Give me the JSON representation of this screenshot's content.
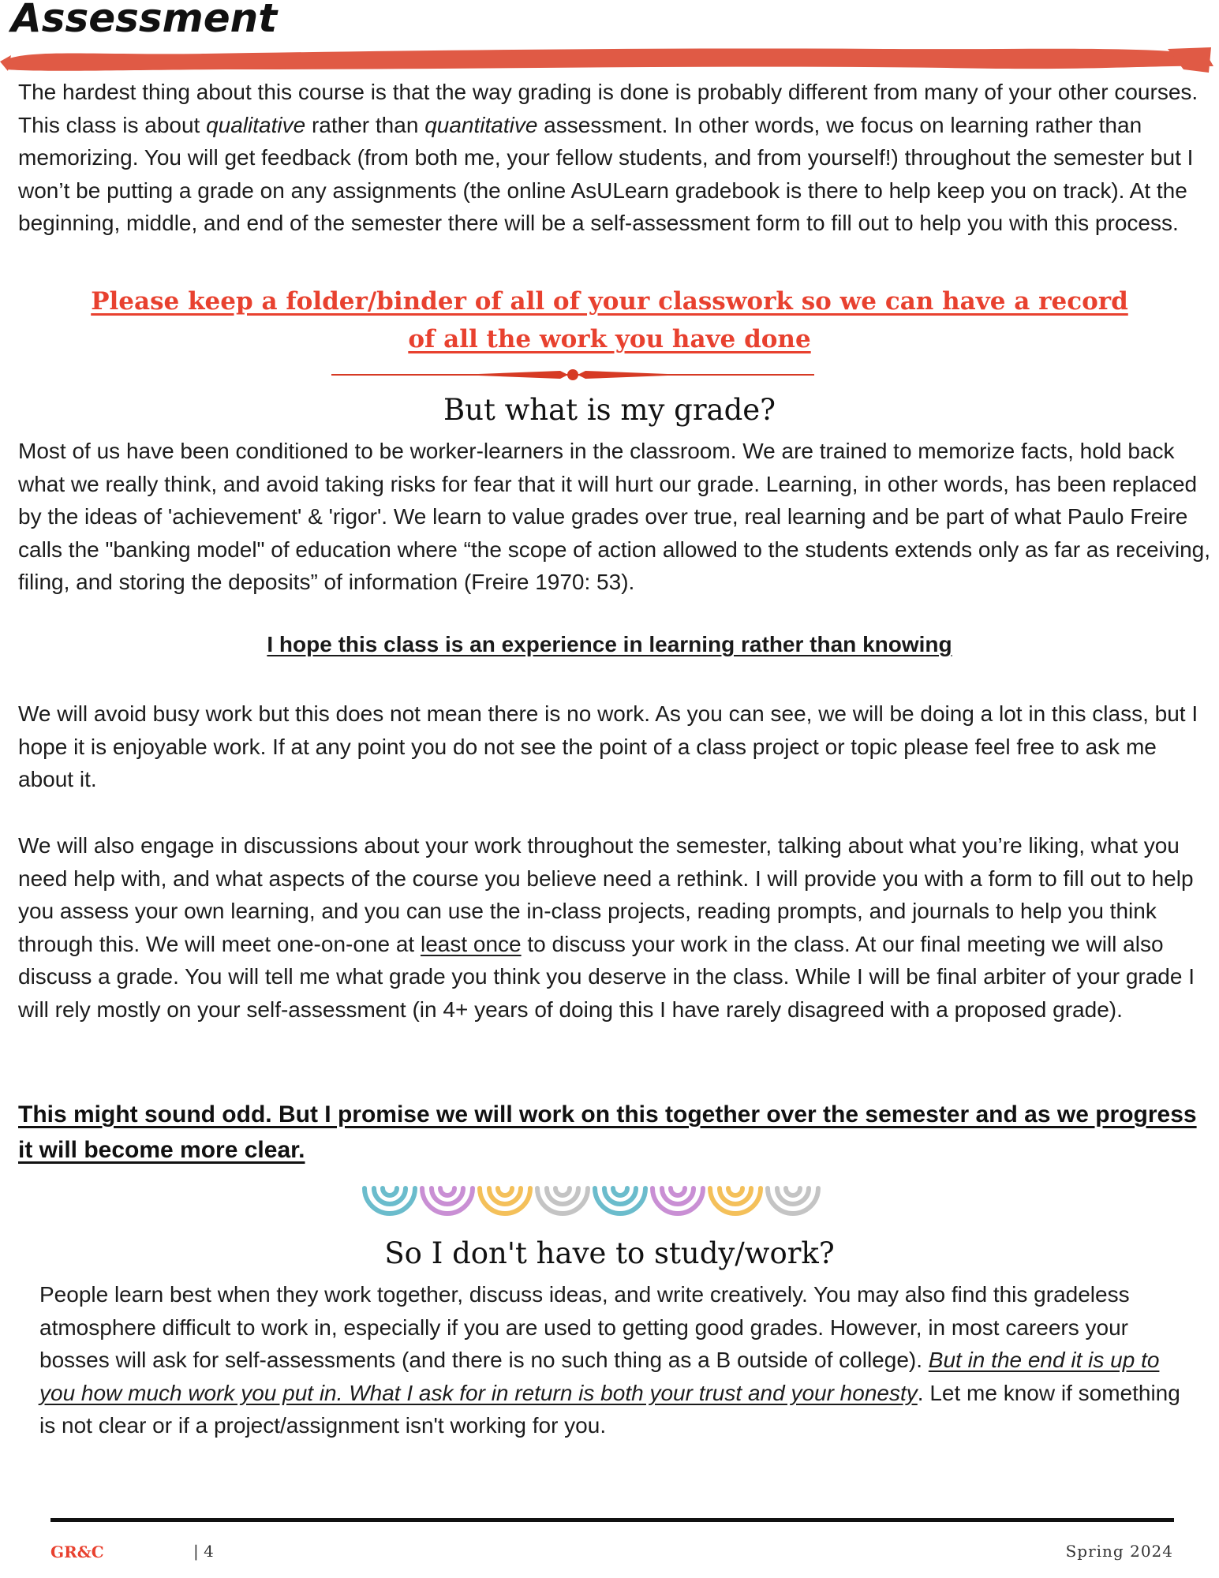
{
  "title": "Assessment",
  "intro": {
    "part1": "The hardest thing about this course is that the way grading is done is probably different from many of your other courses. This class is about ",
    "qualitative": "qualitative",
    "part2": " rather than ",
    "quantitative": "quantitative",
    "part3": " assessment. In other words, we focus on learning rather than memorizing. You will get feedback (from both me, your fellow students, and from yourself!) throughout the semester but I won’t be putting a grade on any assignments (the online AsULearn gradebook is there to help keep you on track). At the beginning, middle, and end of the semester there will be a self-assessment form to fill out to help you with this process."
  },
  "callout": {
    "line1": "Please keep a folder/binder of all of your classwork so we can have a record",
    "line2": "of all the work you have done"
  },
  "section1": {
    "heading": "But what is my grade?",
    "paragraph": "Most of us have been conditioned to be worker-learners in the classroom. We are trained to memorize facts, hold back what we really think, and avoid taking risks for fear that it will hurt our grade. Learning, in other words, has been replaced by the ideas of 'achievement' & 'rigor'. We learn to value grades over true, real learning and be part of what Paulo Freire calls the \"banking model\" of education where “the scope of action allowed to the students extends only as far as receiving, filing, and storing the deposits” of information (Freire 1970: 53).",
    "hope": "I hope this class is an experience in learning rather than knowing ",
    "busy_work": "We will avoid busy work but this does not mean there is no work. As you can see, we will be doing a lot in this class, but I hope it is enjoyable work. If at any point you do not see the point of a class project or topic please feel free to ask me about it.",
    "discuss_part1": "We will also engage in discussions about your work throughout the semester, talking about what you’re liking, what you need help with, and what aspects of the course you believe need a rethink. I will provide you with a form to fill out to help you assess your own learning, and you can use the in-class projects, reading prompts, and journals to help you think through this. We will meet one-on-one at ",
    "least_once": "least once",
    "discuss_part2": " to discuss your work in the class. At our final meeting we will also discuss a grade. You will tell me what grade you think you deserve in the class. While I will be final arbiter of your grade I will rely mostly on your self-assessment (in 4+ years of doing this I have rarely disagreed with a proposed grade).",
    "emphasis": "This might sound odd. But I promise we will work on this together over the semester and as we progress it will become more clear."
  },
  "section2": {
    "heading": "So I don't have to study/work?",
    "part1": "People learn best when they work together, discuss ideas, and write creatively. You may also find this gradeless atmosphere difficult to work in, especially if you are used to getting good grades. However, in most careers your bosses will ask for self-assessments (and there is no such thing as a B outside of college).  ",
    "underlined": "But in the end it is up to you how much work you put in. What I ask for in return is both your trust and your honesty",
    "part2": ". Let me know if something is not clear or if a project/assignment isn't working for you."
  },
  "footer": {
    "course": "GR&C",
    "page": "|  4",
    "term": "Spring 2024"
  },
  "colors": {
    "accent_red": "#e8412f",
    "arc_teal": "#6bbccc",
    "arc_purple": "#c98fd4",
    "arc_yellow": "#f4c05a",
    "arc_gray": "#c4c4c4"
  }
}
